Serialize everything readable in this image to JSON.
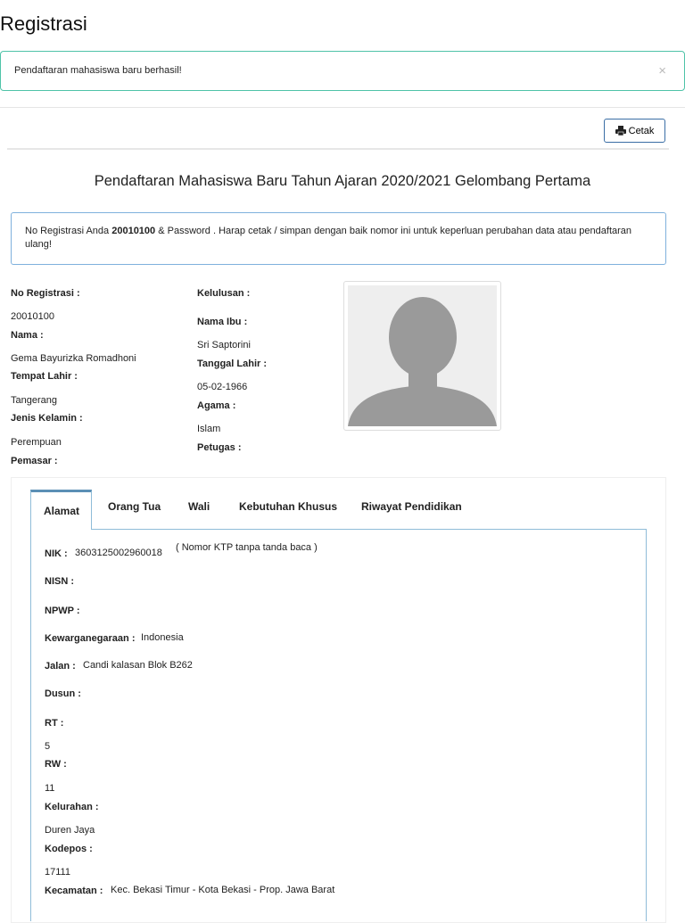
{
  "page_title": "Registrasi",
  "alert": {
    "message": "Pendaftaran mahasiswa baru berhasil!",
    "close": "×"
  },
  "print_button": "Cetak",
  "heading": "Pendaftaran Mahasiswa Baru Tahun Ajaran 2020/2021 Gelombang Pertama",
  "info": {
    "prefix": "No Registrasi Anda ",
    "reg_no": "20010100",
    "suffix": " & Password . Harap cetak / simpan dengan baik nomor ini untuk keperluan perubahan data atau pendaftaran ulang!"
  },
  "profile": {
    "no_reg_label": "No Registrasi :",
    "no_reg": "20010100",
    "nama_label": "Nama :",
    "nama": "Gema Bayurizka Romadhoni",
    "tempat_lahir_label": "Tempat Lahir :",
    "tempat_lahir": "Tangerang",
    "jenis_kelamin_label": "Jenis Kelamin :",
    "jenis_kelamin": "Perempuan",
    "pemasar_label": "Pemasar :",
    "kelulusan_label": "Kelulusan :",
    "nama_ibu_label": "Nama Ibu :",
    "nama_ibu": "Sri Saptorini",
    "tanggal_lahir_label": "Tanggal Lahir :",
    "tanggal_lahir": "05-02-1966",
    "agama_label": "Agama :",
    "agama": "Islam",
    "petugas_label": "Petugas :"
  },
  "tabs": [
    "Alamat",
    "Orang Tua",
    "Wali",
    "Kebutuhan Khusus",
    "Riwayat Pendidikan"
  ],
  "alamat": {
    "nik_label": "NIK :",
    "nik": "3603125002960018",
    "nik_hint": "( Nomor KTP tanpa tanda baca )",
    "nisn_label": "NISN :",
    "npwp_label": "NPWP :",
    "kewarganegaraan_label": "Kewarganegaraan :",
    "kewarganegaraan": "Indonesia",
    "jalan_label": "Jalan :",
    "jalan": "Candi kalasan Blok B262",
    "dusun_label": "Dusun :",
    "rt_label": "RT :",
    "rt": "5",
    "rw_label": "RW :",
    "rw": "11",
    "kelurahan_label": "Kelurahan :",
    "kelurahan": "Duren Jaya",
    "kodepos_label": "Kodepos :",
    "kodepos": "17111",
    "kecamatan_label": "Kecamatan :",
    "kecamatan": "Kec. Bekasi Timur - Kota Bekasi - Prop. Jawa Barat"
  }
}
